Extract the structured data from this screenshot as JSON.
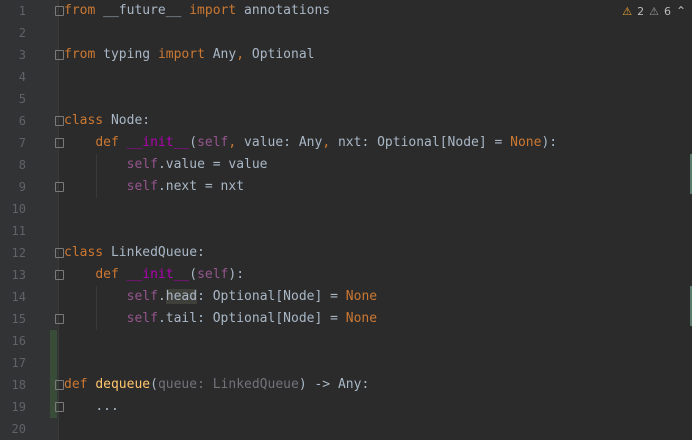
{
  "editor": {
    "inspections": {
      "warnings_count": "2",
      "weak_warnings_count": "6",
      "warning_icon": "warning-triangle-icon",
      "weak_warning_icon": "weak-warning-triangle-icon",
      "collapse_icon": "chevron-up-icon"
    },
    "line_numbers": [
      "1",
      "2",
      "3",
      "4",
      "5",
      "6",
      "7",
      "8",
      "9",
      "10",
      "11",
      "12",
      "13",
      "14",
      "15",
      "16",
      "17",
      "18",
      "19",
      "20"
    ],
    "code": {
      "l1_from": "from",
      "l1_module": " __future__ ",
      "l1_import": "import",
      "l1_names": " annotations",
      "l3_from": "from",
      "l3_module": " typing ",
      "l3_import": "import",
      "l3_names1": " Any",
      "l3_comma": ",",
      "l3_names2": " Optional",
      "l6_class": "class",
      "l6_name": " Node:",
      "l7_indent": "    ",
      "l7_def": "def",
      "l7_sp": " ",
      "l7_init": "__init__",
      "l7_open": "(",
      "l7_self": "self",
      "l7_comma1": ",",
      "l7_p1": " value: Any",
      "l7_comma2": ",",
      "l7_p2": " nxt: Optional[Node] = ",
      "l7_none": "None",
      "l7_close": "):",
      "l8_indent": "        ",
      "l8_self": "self",
      "l8_rest": ".value = value",
      "l9_indent": "        ",
      "l9_self": "self",
      "l9_rest": ".next = nxt",
      "l12_class": "class",
      "l12_name": " LinkedQueue:",
      "l13_indent": "    ",
      "l13_def": "def",
      "l13_sp": " ",
      "l13_init": "__init__",
      "l13_open": "(",
      "l13_self": "self",
      "l13_close": "):",
      "l14_indent": "        ",
      "l14_self": "self",
      "l14_dot": ".",
      "l14_attr": "head",
      "l14_rest": ": Optional[Node] = ",
      "l14_none": "None",
      "l15_indent": "        ",
      "l15_self": "self",
      "l15_rest": ".tail: Optional[Node] = ",
      "l15_none": "None",
      "l18_def": "def",
      "l18_sp": " ",
      "l18_fn": "dequeue",
      "l18_open": "(",
      "l18_param": "queue: LinkedQueue",
      "l18_rest": ") -> Any:",
      "l19_indent": "    ",
      "l19_body": "..."
    }
  }
}
